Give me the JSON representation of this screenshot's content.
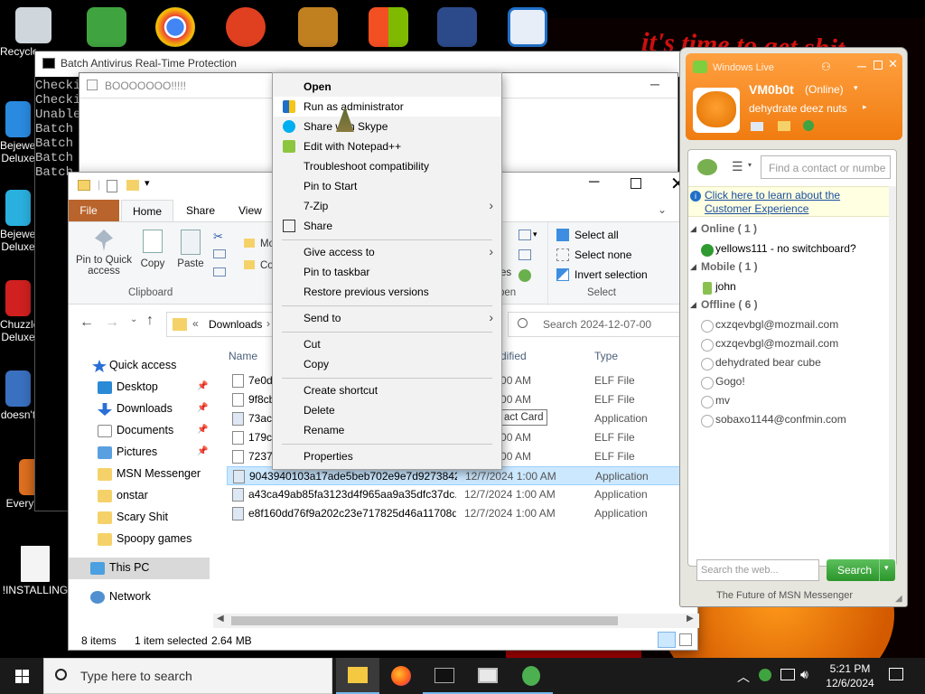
{
  "desktop": {
    "wallpaper_text": "it's time to get shit",
    "icons": [
      {
        "label": "Recycle Bin",
        "icon": "recycle-bin-icon"
      },
      {
        "label": "Bejeweled Deluxe",
        "icon": "bejeweled-icon"
      },
      {
        "label": "Bejeweled Deluxe",
        "icon": "bejeweled-icon"
      },
      {
        "label": "Chuzzle Deluxe",
        "icon": "chuzzle-icon"
      },
      {
        "label": "doesn't",
        "icon": "app-icon"
      },
      {
        "label": "Everything",
        "icon": "everything-icon"
      },
      {
        "label": "!INSTALLING",
        "icon": "text-file-icon"
      }
    ],
    "top_icons": [
      "msn-icon",
      "chrome-icon",
      "p-icon",
      "winrar-icon",
      "windows-shield-icon",
      "anime-icon",
      "window-icon"
    ]
  },
  "cmd_window": {
    "title": "Batch Antivirus Real-Time Protection",
    "lines": [
      "Checki",
      "Checki",
      "Unable",
      "Batch",
      "Batch",
      "Batch",
      "Batch"
    ]
  },
  "msgbox": {
    "title": "BOOOOOOO!!!!!"
  },
  "explorer": {
    "tabs": [
      "File",
      "Home",
      "Share",
      "View"
    ],
    "ribbon": {
      "pin_label": "Pin to Quick access",
      "copy_label": "Copy",
      "paste_label": "Paste",
      "move_label": "Mo",
      "copy_to_label": "Co",
      "clipboard_group": "Clipboard",
      "select_all": "Select all",
      "select_none": "Select none",
      "invert_selection": "Invert selection",
      "select_group": "Select",
      "open_group": "pen",
      "properties_frag": "es"
    },
    "address": {
      "path_prefix": "«",
      "path": "Downloads",
      "search_placeholder": "Search 2024-12-07-00"
    },
    "columns": {
      "name": "Name",
      "date": "dified",
      "type": "Type"
    },
    "nav": {
      "quick_access": "Quick access",
      "items": [
        {
          "label": "Desktop",
          "pinned": true
        },
        {
          "label": "Downloads",
          "pinned": true
        },
        {
          "label": "Documents",
          "pinned": true
        },
        {
          "label": "Pictures",
          "pinned": true
        },
        {
          "label": "MSN Messenger",
          "pinned": false
        },
        {
          "label": "onstar",
          "pinned": false
        },
        {
          "label": "Scary Shit",
          "pinned": false
        },
        {
          "label": "Spoopy games",
          "pinned": false
        }
      ],
      "this_pc": "This PC",
      "network": "Network"
    },
    "files": [
      {
        "name": "7e0d6",
        "date": "2024 1:00 AM",
        "type": "ELF File"
      },
      {
        "name": "9f8cb",
        "date": "2024 1:00 AM",
        "type": "ELF File"
      },
      {
        "name": "73acf",
        "date": "act Card",
        "type": "Application"
      },
      {
        "name": "179c9",
        "date": "2024 1:00 AM",
        "type": "ELF File"
      },
      {
        "name": "7237c",
        "date": "2024 1:00 AM",
        "type": "ELF File"
      },
      {
        "name": "9043940103a17ade5beb702e9e7d9273842...",
        "date": "12/7/2024 1:00 AM",
        "type": "Application",
        "selected": true
      },
      {
        "name": "a43ca49ab85fa3123d4f965aa9a35dfc37dc...",
        "date": "12/7/2024 1:00 AM",
        "type": "Application"
      },
      {
        "name": "e8f160dd76f9a202c23e717825d46a11708d...",
        "date": "12/7/2024 1:00 AM",
        "type": "Application"
      }
    ],
    "status": {
      "items": "8 items",
      "selected": "1 item selected",
      "size": "2.64 MB"
    }
  },
  "context_menu": {
    "items": [
      {
        "label": "Open",
        "bold": true
      },
      {
        "label": "Run as administrator",
        "icon": "shield-icon",
        "highlighted": true
      },
      {
        "label": "Share with Skype",
        "icon": "skype-icon"
      },
      {
        "label": "Edit with Notepad++",
        "icon": "notepadpp-icon"
      },
      {
        "label": "Troubleshoot compatibility"
      },
      {
        "label": "Pin to Start"
      },
      {
        "label": "7-Zip",
        "submenu": true
      },
      {
        "label": "Share",
        "icon": "share-icon"
      },
      {
        "label": "Give access to",
        "submenu": true
      },
      {
        "label": "Pin to taskbar"
      },
      {
        "label": "Restore previous versions"
      },
      {
        "label": "Send to",
        "submenu": true
      },
      {
        "label": "Cut"
      },
      {
        "label": "Copy"
      },
      {
        "label": "Create shortcut"
      },
      {
        "label": "Delete"
      },
      {
        "label": "Rename"
      },
      {
        "label": "Properties"
      }
    ]
  },
  "msn": {
    "title": "Windows Live",
    "username": "VM0b0t",
    "status": "(Online)",
    "personal_message": "dehydrate deez nuts",
    "search_contact_placeholder": "Find a contact or number",
    "info_link": "Click here to learn about the Customer Experience",
    "groups": [
      {
        "label": "Online ( 1 )",
        "contacts": [
          "yellows111 - no switchboard?"
        ]
      },
      {
        "label": "Mobile ( 1 )",
        "contacts": [
          "john"
        ]
      },
      {
        "label": "Offline ( 6 )",
        "contacts": [
          "cxzqevbgl@mozmail.com",
          "cxzqevbgl@mozmail.com",
          "dehydrated bear cube",
          "Gogo!",
          "mv",
          "sobaxo1144@confmin.com"
        ]
      }
    ],
    "web_search_placeholder": "Search the web...",
    "search_button": "Search",
    "footer": "The Future of MSN Messenger"
  },
  "taskbar": {
    "search_placeholder": "Type here to search",
    "time": "5:21 PM",
    "date": "12/6/2024",
    "apps": [
      "file-explorer-icon",
      "firefox-icon",
      "terminal-icon",
      "window-app-icon",
      "msn-messenger-icon"
    ]
  }
}
